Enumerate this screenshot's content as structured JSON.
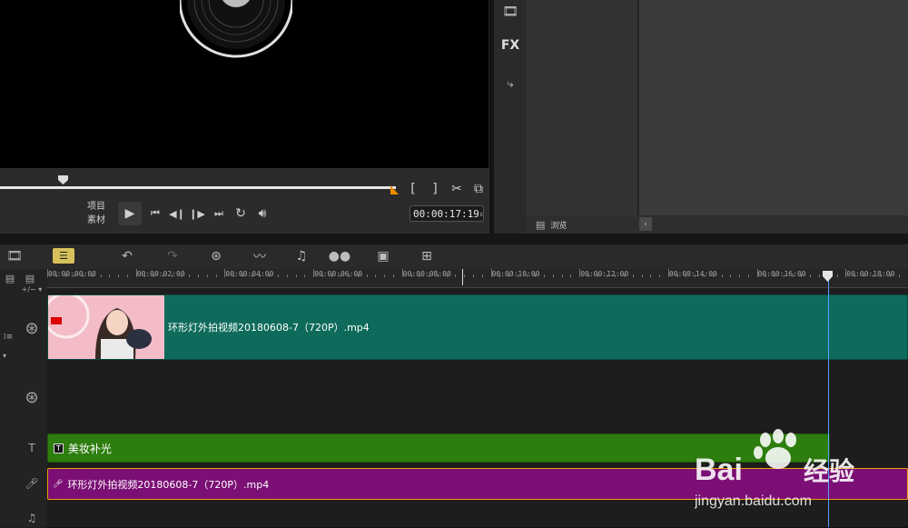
{
  "player": {
    "mode_project": "项目",
    "mode_clip": "素材",
    "timecode": "00:00:17:19",
    "mark_in": "[",
    "mark_out": "]"
  },
  "library": {
    "fx_label": "FX",
    "browse_label": "浏览"
  },
  "ruler": {
    "labels": [
      "00:00:00:00",
      "00:00:02:00",
      "00:00:04:00",
      "00:00:06:00",
      "00:00:08:00",
      "00:00:10:00",
      "00:00:12:00",
      "00:00:14:00",
      "00:00:16:00",
      "00:00:18:00"
    ]
  },
  "tracks": {
    "video_clip_name": "环形灯外拍视频20180608-7（720P）.mp4",
    "title_clip_name": "美妆补光",
    "voice_clip_name": "环形灯外拍视频20180608-7（720P）.mp4",
    "title_badge": "T"
  },
  "watermark": {
    "brand": "Bai",
    "brand_suffix": "经验",
    "url": "jingyan.baidu.com"
  },
  "colors": {
    "video_clip": "#0e6b5b",
    "title_clip": "#2d7d0f",
    "voice_clip": "#7b0f75",
    "playhead": "#5aa0ff"
  }
}
